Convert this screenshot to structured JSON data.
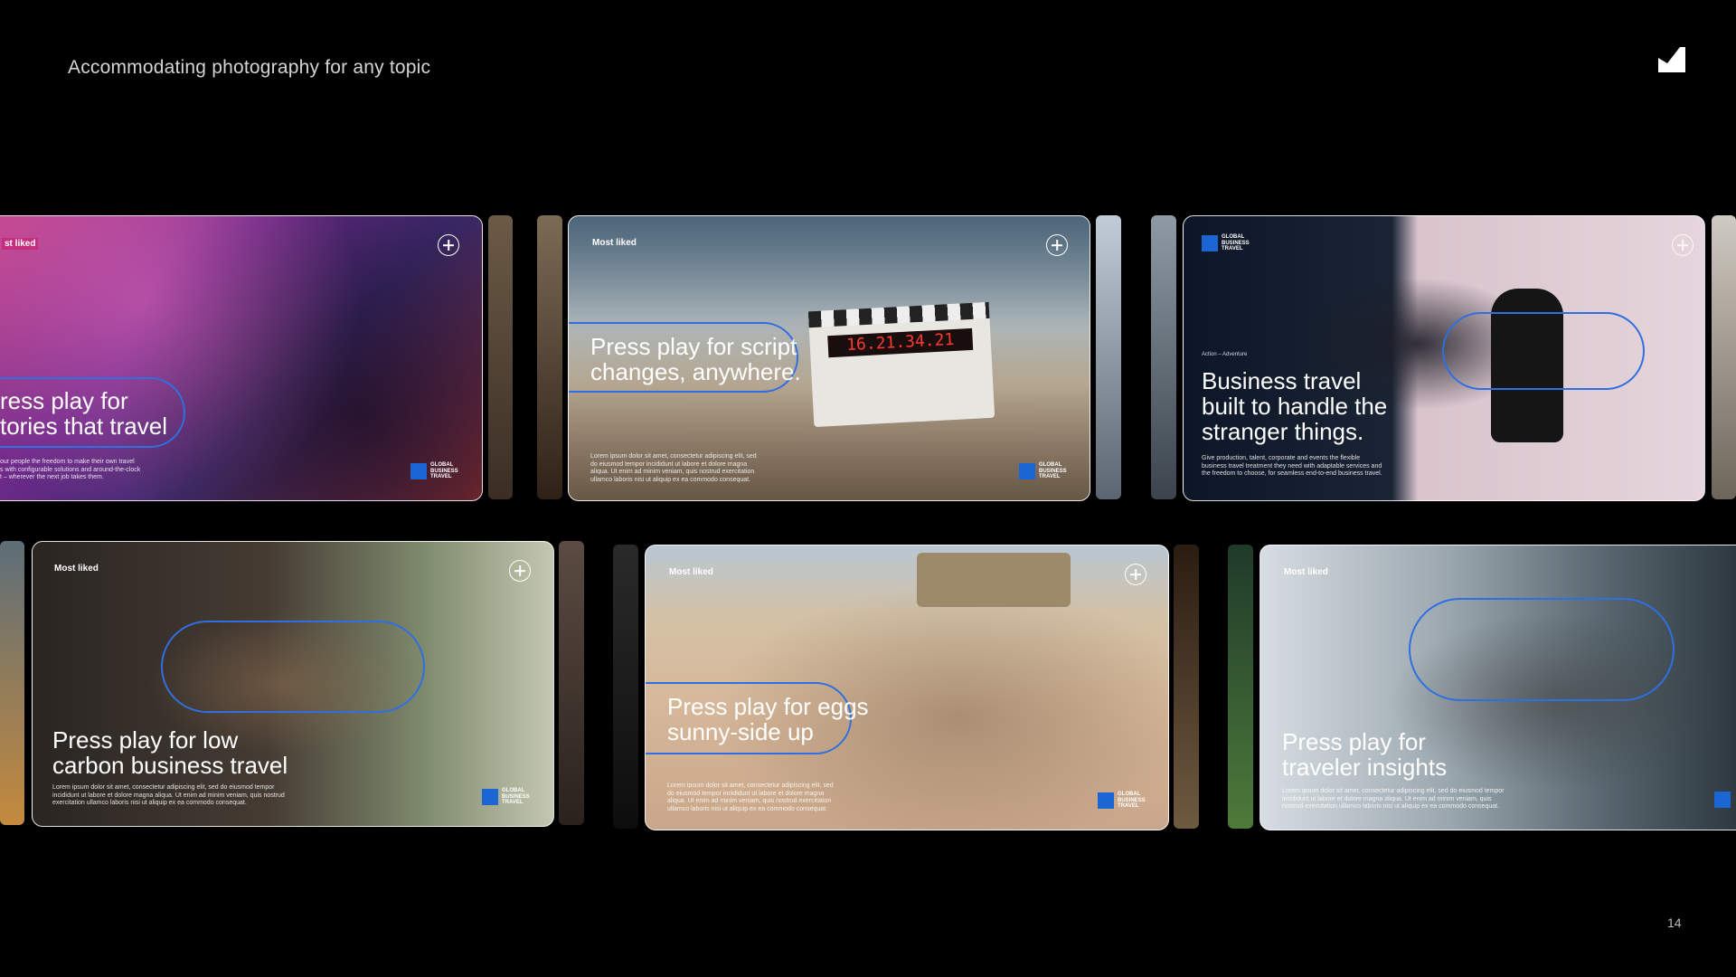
{
  "page": {
    "title": "Accommodating photography for any topic",
    "number": "14"
  },
  "brand": {
    "mark": "AMERICAN EXPRESS",
    "name": "GLOBAL BUSINESS TRAVEL"
  },
  "cards": [
    {
      "tag": "st liked",
      "headline": "ress play for\ntories that travel",
      "body": "our people the freedom to make their own travel\ns with configurable solutions and around-the-clock\nt – wherever the next job takes them."
    },
    {
      "tag": "Most liked",
      "headline": "Press play for script\nchanges, anywhere.",
      "body": "Lorem ipsum dolor sit amet, consectetur adipiscing elit, sed\ndo eiusmod tempor incididunt ut labore et dolore magna\naliqua. Ut enim ad minim veniam, quis nostrud exercitation\nullamco laboris nisi ut aliquip ex ea commodo consequat."
    },
    {
      "eyebrow": "Action – Adventure",
      "headline_accent": "Business travel",
      "headline": "built to handle the\nstranger things.",
      "body": "Give production, talent, corporate and events the flexible\nbusiness travel treatment they need with adaptable services and\nthe freedom to choose, for seamless end-to-end business travel."
    },
    {
      "tag": "Most liked",
      "headline": "Press play for low\ncarbon business travel",
      "body": "Lorem ipsum dolor sit amet, consectetur adipiscing elit, sed do eiusmod tempor\nincididunt ut labore et dolore magna aliqua. Ut enim ad minim veniam, quis nostrud\nexercitation ullamco laboris nisi ut aliquip ex ea commodo consequat."
    },
    {
      "tag": "Most liked",
      "headline": "Press play for eggs\nsunny-side up",
      "body": "Lorem ipsum dolor sit amet, consectetur adipiscing elit, sed\ndo eiusmod tempor incididunt ut labore et dolore magna\naliqua. Ut enim ad minim veniam, quis nostrud exercitation\nullamco laboris nisi ut aliquip ex ea commodo consequat."
    },
    {
      "tag": "Most liked",
      "headline": "Press play for\ntraveler insights",
      "body": "Lorem ipsum dolor sit amet, consectetur adipiscing elit, sed do eiusmod tempor\nincididunt ut labore et dolore magna aliqua. Ut enim ad minim veniam, quis\nnostrud exercitation ullamco laboris nisi ut aliquip ex ea commodo consequat."
    }
  ],
  "colors": {
    "accent": "#2f6fe0",
    "background": "#000000"
  }
}
